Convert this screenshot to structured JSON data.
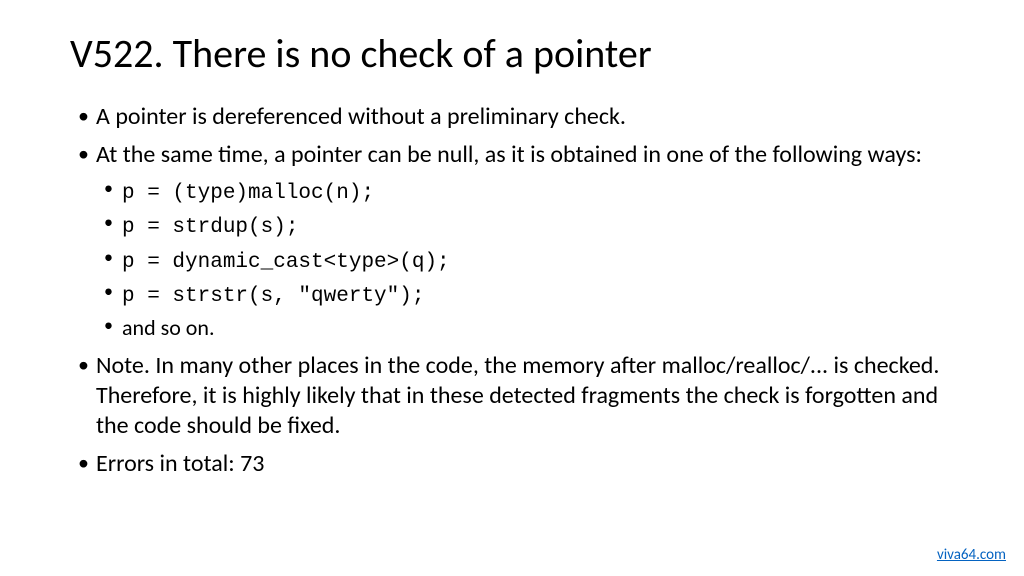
{
  "title": "V522. There is no check of a pointer",
  "bullets": {
    "b1": "A pointer is dereferenced without a preliminary check.",
    "b2": "At the same time, a pointer can be null, as it is obtained in one of the following ways:",
    "sub": {
      "s1": "p = (type)malloc(n);",
      "s2": "p = strdup(s);",
      "s3": "p = dynamic_cast<type>(q);",
      "s4": "p = strstr(s, \"qwerty\");",
      "s5": "and so on."
    },
    "b3": "Note. In many other places in the code, the memory after malloc/realloc/... is checked. Therefore, it is highly likely that in these detected fragments the check is forgotten and the code should be fixed.",
    "b4": "Errors in total: 73"
  },
  "footer_link": "viva64.com"
}
